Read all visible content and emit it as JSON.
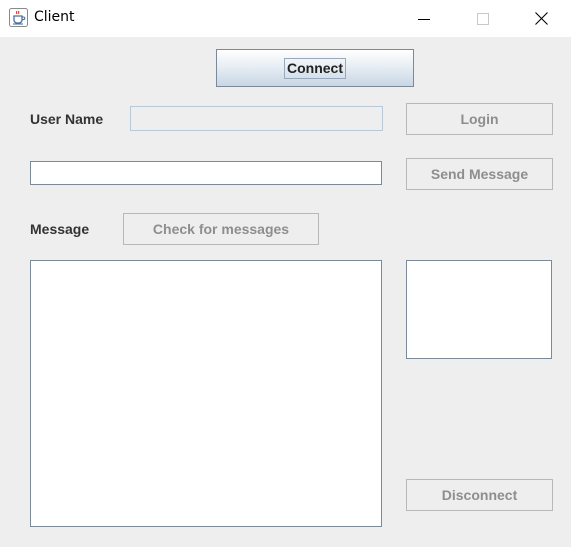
{
  "window": {
    "title": "Client",
    "icon": "java-coffee-cup-icon",
    "controls": [
      "minimize-icon",
      "maximize-icon",
      "close-icon"
    ]
  },
  "toolbar": {
    "connect_label": "Connect"
  },
  "login": {
    "username_label": "User Name",
    "username_value": "",
    "login_label": "Login"
  },
  "compose": {
    "message_value": "",
    "send_label": "Send Message"
  },
  "inbox": {
    "message_label": "Message",
    "check_label": "Check for messages",
    "messages_text": ""
  },
  "users": {
    "items": []
  },
  "session": {
    "disconnect_label": "Disconnect"
  },
  "colors": {
    "background": "#eeeeee",
    "disabled_text": "#8e8e8e",
    "label_text": "#333333",
    "field_border": "#7a8a99"
  }
}
